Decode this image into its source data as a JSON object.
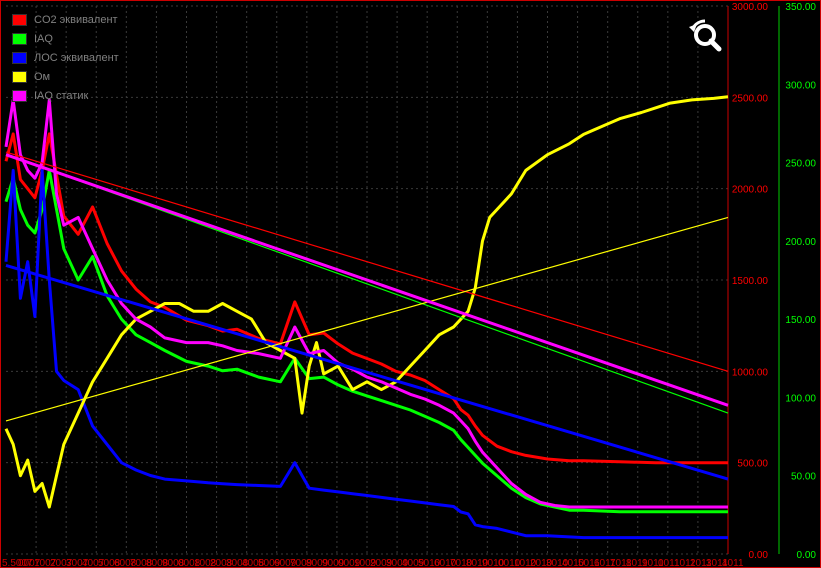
{
  "chart_data": {
    "type": "line",
    "title": "",
    "xlabel": "",
    "ylabel": "",
    "x_tick_labels": [
      "5.5007",
      "0007",
      "1007",
      "2007",
      "3007",
      "4007",
      "5008",
      "6008",
      "7008",
      "8008",
      "9008",
      "0008",
      "1008",
      "2008",
      "3008",
      "4008",
      "5009",
      "6009",
      "7009",
      "8009",
      "9009",
      "0009",
      "1009",
      "2009",
      "3009",
      "4009",
      "5010",
      "6010",
      "7010",
      "8010",
      "9010",
      "0010",
      "1010",
      "2010",
      "3010",
      "4010",
      "5011",
      "6011",
      "7011",
      "8011",
      "9011",
      "0011",
      "1011",
      "2011",
      "3011",
      "4011",
      "5011",
      "6011",
      "7011",
      "8011",
      "9011",
      "0011",
      "1011",
      "2011",
      "3011",
      "4011",
      "5011",
      "6011",
      "7011",
      "8011",
      "9011",
      "0011",
      "1011",
      "2011",
      "3011",
      "4011",
      "5011",
      "6011",
      "7011",
      "8011",
      "9011",
      "0011",
      "1011",
      "2011",
      "3011",
      "4011",
      "5011",
      "6011",
      "7011",
      "8011",
      "9011",
      "0011",
      "1011",
      "2011",
      "3011",
      "4011",
      "5011",
      "6011",
      "7011",
      "8011",
      "9011",
      "0011",
      "1011",
      "2011",
      "3011",
      "4011",
      "5011",
      "6011",
      "7011",
      "8011",
      "9011",
      "0011",
      "1011",
      "2011",
      "3011",
      "4011",
      "5011",
      "6011",
      "7011",
      "8011",
      "9011",
      "0011",
      "1011",
      "2011",
      "3011",
      "4011",
      "5011",
      "6011",
      "7011",
      "8011",
      "9011",
      "0011",
      "1011",
      "2011",
      "3011",
      "4011",
      "5011",
      "6011",
      "7011",
      "8011",
      "9011",
      "0011",
      "1011",
      "2011",
      "3011",
      "4011",
      "5011",
      "6011",
      "7011",
      "8011",
      "9011",
      "0011",
      "1011",
      "2011",
      "3011",
      "4011",
      "5011",
      "6011",
      "7011",
      "8011",
      "9011",
      "0011",
      "1011",
      "2011",
      "3011",
      "4011",
      "5011",
      "6011",
      "7011",
      "8011",
      "9011",
      "0011",
      "1011",
      "2011",
      "3011",
      "4011",
      "5011",
      "6011",
      "7011",
      "8011",
      "9011",
      "0011",
      "1011",
      "2011",
      "3011",
      "4011",
      "5011",
      "6011",
      "7011",
      "8011",
      "9011",
      "0011",
      "1011",
      "2011",
      "3011",
      "4011",
      "5011",
      "6011",
      "7011",
      "8011",
      "9011",
      "0011",
      "1011",
      "2011",
      "3011",
      "4011",
      "5011",
      "6011",
      "7011",
      "8011",
      "9011",
      "0011",
      "1011",
      "2011",
      "3011",
      "4011",
      "5011",
      "6011",
      "7011",
      "8011",
      "9011",
      "0011",
      "1011",
      "2011",
      "3011",
      "4011",
      "5011",
      "6011",
      "7011",
      "8011",
      "9011",
      "0011",
      "1011",
      "2011",
      "3011",
      "4011",
      "5011",
      "6011",
      "7011",
      "8011",
      "9011",
      "0011",
      "1011",
      "2011",
      "3011",
      "4011",
      "5011",
      "6011",
      "7011",
      "8011",
      "9011",
      "0011",
      "1011",
      "2011",
      "3011",
      "4011",
      "5011",
      "6011",
      "7011",
      "8011",
      "9011",
      "0011",
      "1011",
      "2011",
      "3011",
      "4011",
      "5011",
      "6011",
      "7011",
      "8011",
      "9011",
      "0011",
      "1011",
      "2011",
      "3011",
      "4011",
      "5011",
      "6011",
      "7011",
      "8011",
      "9011",
      "0011",
      "1011",
      "2011",
      "3011",
      "4011",
      "5011",
      "6011",
      "7011",
      "8011",
      "9011",
      "0011",
      "1011",
      "2011",
      "3011",
      "4011",
      "5011",
      "6011",
      "7011",
      "8011",
      "9011",
      "0011",
      "1011",
      "2011",
      "3011",
      "4011",
      "5011",
      "6011",
      "7011",
      "8011",
      "9011",
      "0011",
      "1011",
      "2011",
      "3011",
      "4011",
      "5011",
      "6011",
      "7011",
      "8011",
      "9011",
      "0011",
      "1011",
      "2011",
      "3011",
      "4011",
      "5011",
      "6011",
      "7011",
      "8011",
      "9011",
      "0011",
      "1011",
      "2011",
      "3011",
      "4011",
      "5011",
      "6011",
      "7011",
      "8011",
      "9011",
      "0011",
      "1011",
      "2011",
      "3011",
      "4011"
    ],
    "x_range": [
      0,
      100
    ],
    "y_left": {
      "range": [
        0,
        3000
      ],
      "ticks": [
        "0.00",
        "500.00",
        "1000.00",
        "1500.00",
        "2000.00",
        "2500.00",
        "3000.00"
      ],
      "color": "#ff0000"
    },
    "y_right": {
      "range": [
        0,
        350
      ],
      "ticks": [
        "0.00",
        "50.00",
        "100.00",
        "150.00",
        "200.00",
        "250.00",
        "300.00",
        "350.00"
      ],
      "color": "#00ff00"
    },
    "grid": true,
    "legend_position": "top-left",
    "series": [
      {
        "name": "CO2 эквивалент",
        "color": "#ff0000",
        "axis": "left",
        "x": [
          0,
          1,
          2,
          3,
          4,
          5,
          6,
          8,
          10,
          12,
          14,
          16,
          18,
          20,
          22,
          25,
          28,
          30,
          32,
          35,
          38,
          40,
          42,
          44,
          46,
          48,
          50,
          52,
          54,
          56,
          58,
          60,
          62,
          63,
          64,
          65,
          66,
          67,
          68,
          70,
          72,
          75,
          78,
          80,
          85,
          90,
          95,
          100
        ],
        "y": [
          2150,
          2300,
          2050,
          2000,
          1950,
          2100,
          2300,
          1850,
          1750,
          1900,
          1700,
          1550,
          1450,
          1380,
          1350,
          1280,
          1250,
          1220,
          1230,
          1180,
          1150,
          1380,
          1200,
          1210,
          1150,
          1100,
          1070,
          1040,
          1000,
          980,
          950,
          900,
          850,
          790,
          760,
          700,
          650,
          620,
          590,
          560,
          540,
          520,
          510,
          510,
          505,
          500,
          500,
          500
        ]
      },
      {
        "name": "IAQ",
        "color": "#00ff00",
        "axis": "right",
        "x": [
          0,
          1,
          2,
          3,
          4,
          5,
          6,
          8,
          10,
          12,
          14,
          16,
          18,
          20,
          22,
          25,
          28,
          30,
          32,
          35,
          38,
          40,
          42,
          44,
          46,
          48,
          50,
          52,
          54,
          56,
          58,
          60,
          62,
          63,
          64,
          65,
          66,
          68,
          70,
          72,
          74,
          76,
          78,
          80,
          85,
          90,
          95,
          100
        ],
        "y": [
          225,
          240,
          220,
          210,
          205,
          220,
          245,
          195,
          175,
          190,
          165,
          150,
          140,
          135,
          130,
          123,
          120,
          117,
          118,
          113,
          110,
          125,
          112,
          113,
          108,
          104,
          101,
          98,
          95,
          92,
          88,
          84,
          79,
          73,
          68,
          63,
          58,
          50,
          42,
          36,
          32,
          30,
          28,
          28,
          27,
          27,
          27,
          27
        ]
      },
      {
        "name": "ЛОС эквивалент",
        "color": "#0000ff",
        "axis": "left",
        "x": [
          0,
          1,
          2,
          3,
          4,
          5,
          6,
          7,
          8,
          10,
          12,
          14,
          16,
          18,
          20,
          22,
          25,
          28,
          30,
          32,
          35,
          38,
          40,
          42,
          44,
          46,
          48,
          50,
          52,
          54,
          56,
          58,
          60,
          62,
          63,
          64,
          65,
          66,
          68,
          70,
          72,
          75,
          80,
          85,
          90,
          95,
          100
        ],
        "y": [
          1600,
          2100,
          1400,
          1600,
          1300,
          2100,
          1500,
          1000,
          950,
          900,
          700,
          600,
          500,
          460,
          430,
          410,
          400,
          390,
          385,
          380,
          375,
          370,
          500,
          360,
          350,
          340,
          330,
          320,
          310,
          300,
          290,
          280,
          270,
          260,
          230,
          220,
          160,
          150,
          140,
          120,
          100,
          100,
          90,
          90,
          90,
          90,
          90
        ]
      },
      {
        "name": "Ом",
        "color": "#ffff00",
        "axis": "right",
        "x": [
          0,
          1,
          2,
          3,
          4,
          5,
          6,
          7,
          8,
          10,
          12,
          14,
          16,
          18,
          20,
          22,
          24,
          26,
          28,
          30,
          32,
          34,
          36,
          38,
          40,
          41,
          42,
          43,
          44,
          46,
          48,
          50,
          52,
          54,
          56,
          58,
          60,
          62,
          64,
          65,
          66,
          67,
          68,
          70,
          72,
          75,
          78,
          80,
          82,
          85,
          88,
          90,
          92,
          95,
          98,
          100
        ],
        "y": [
          80,
          70,
          50,
          60,
          40,
          45,
          30,
          50,
          70,
          90,
          110,
          125,
          140,
          150,
          155,
          160,
          160,
          155,
          155,
          160,
          155,
          150,
          135,
          130,
          125,
          90,
          120,
          135,
          115,
          120,
          105,
          110,
          105,
          110,
          120,
          130,
          140,
          145,
          155,
          170,
          200,
          215,
          220,
          230,
          245,
          255,
          262,
          268,
          272,
          278,
          282,
          285,
          288,
          290,
          291,
          292
        ]
      },
      {
        "name": "IAQ статик",
        "color": "#ff00ff",
        "axis": "right",
        "x": [
          0,
          1,
          2,
          3,
          4,
          5,
          6,
          7,
          8,
          10,
          12,
          14,
          16,
          18,
          20,
          22,
          25,
          28,
          30,
          32,
          35,
          38,
          40,
          42,
          44,
          46,
          48,
          50,
          52,
          54,
          56,
          58,
          60,
          62,
          63,
          64,
          65,
          66,
          68,
          70,
          72,
          74,
          76,
          78,
          80,
          85,
          90,
          95,
          100
        ],
        "y": [
          260,
          290,
          255,
          245,
          240,
          250,
          290,
          230,
          210,
          215,
          195,
          175,
          160,
          150,
          145,
          138,
          135,
          135,
          133,
          130,
          128,
          125,
          145,
          128,
          130,
          122,
          118,
          113,
          110,
          106,
          102,
          99,
          95,
          90,
          85,
          80,
          72,
          65,
          55,
          45,
          38,
          33,
          31,
          30,
          30,
          30,
          30,
          30,
          30
        ]
      },
      {
        "name": "",
        "color": "#ff0000",
        "axis": "left",
        "trend": true,
        "x": [
          0,
          100
        ],
        "y": [
          2200,
          1000
        ]
      },
      {
        "name": "",
        "color": "#00ff00",
        "axis": "right",
        "trend": true,
        "x": [
          0,
          100
        ],
        "y": [
          255,
          90
        ]
      },
      {
        "name": "",
        "color": "#0000ff",
        "axis": "left",
        "trend": true,
        "x": [
          0,
          100
        ],
        "y": [
          1580,
          410
        ]
      },
      {
        "name": "",
        "color": "#ffff00",
        "axis": "right",
        "trend": true,
        "x": [
          0,
          100
        ],
        "y": [
          85,
          215
        ]
      },
      {
        "name": "",
        "color": "#ff00ff",
        "axis": "right",
        "trend": true,
        "x": [
          0,
          100
        ],
        "y": [
          255,
          95
        ]
      }
    ]
  },
  "ui": {
    "zoom_icon": "zoom-reset-icon"
  }
}
